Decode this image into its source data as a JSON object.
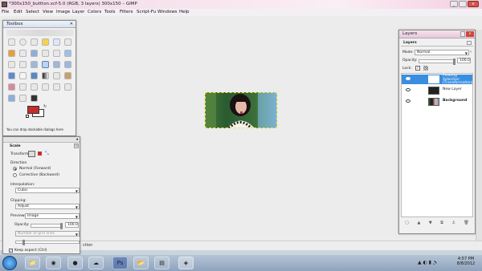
{
  "window": {
    "title": "*300x150_buttton.xcf-5.0 (RGB, 3 layers) 300x150 – GIMP",
    "menus": [
      "File",
      "Edit",
      "Select",
      "View",
      "Image",
      "Layer",
      "Colors",
      "Tools",
      "Filters",
      "Script-Fu",
      "Windows",
      "Help"
    ]
  },
  "toolbox": {
    "title": "Toolbox",
    "close_glyph": "✕",
    "hint": "You can drop dockable dialogs here",
    "fg_color": "#c62c2c",
    "bg_color": "#ffffff"
  },
  "tool_options": {
    "tool_name": "Scale",
    "transform_label": "Transform:",
    "direction_label": "Direction",
    "direction_options": [
      "Normal (Forward)",
      "Corrective (Backward)"
    ],
    "interpolation_label": "Interpolation:",
    "interpolation_value": "Cubic",
    "clipping_label": "Clipping:",
    "clipping_value": "Adjust",
    "preview_label": "Preview:",
    "preview_value": "Image",
    "opacity_label": "Opacity:",
    "opacity_value": "100.0",
    "grid_lines_placeholder": "Number of grid lines",
    "grid_lines_value": "15",
    "keep_aspect_label": "Keep aspect  (Ctrl)"
  },
  "status": {
    "text": "ction"
  },
  "layers": {
    "window_title": "Layers",
    "panel_title": "Layers",
    "mode_label": "Mode:",
    "mode_value": "Normal",
    "opacity_label": "Opacity:",
    "opacity_value": "100.0",
    "lock_label": "Lock:",
    "items": [
      {
        "name": "Floating Selection (Transformation)",
        "selected": true
      },
      {
        "name": "New Layer",
        "selected": false
      },
      {
        "name": "Background",
        "selected": false
      }
    ],
    "close_glyph": "✕"
  },
  "taskbar": {
    "time": "4:57 PM",
    "date": "8/8/2012"
  }
}
